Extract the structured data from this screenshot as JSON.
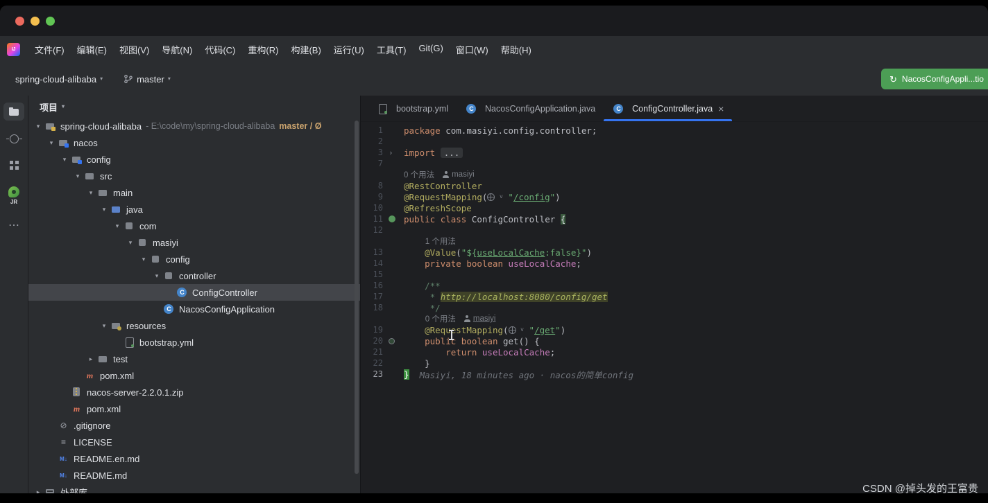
{
  "window": {
    "watermark": "CSDN @掉头发的王富贵"
  },
  "menu_bar": {
    "logo": "IJ",
    "items": [
      "文件(F)",
      "编辑(E)",
      "视图(V)",
      "导航(N)",
      "代码(C)",
      "重构(R)",
      "构建(B)",
      "运行(U)",
      "工具(T)",
      "Git(G)",
      "窗口(W)",
      "帮助(H)"
    ]
  },
  "toolbar": {
    "project_selector": "spring-cloud-alibaba",
    "branch": "master",
    "run_config_label": "NacosConfigAppli...tio"
  },
  "tool_stripe": {
    "items": [
      {
        "name": "project-tool-window",
        "icon": "folder",
        "active": true
      },
      {
        "name": "commit-tool-window",
        "icon": "commit"
      },
      {
        "name": "structure-tool-window",
        "icon": "structure"
      },
      {
        "name": "jrebel-plugin",
        "icon": "jrebel",
        "label": "JR"
      },
      {
        "name": "more-tool-windows",
        "icon": "more"
      }
    ]
  },
  "project_tree": {
    "header": "项目",
    "items": [
      {
        "level": 0,
        "label": "spring-cloud-alibaba",
        "suffix": "- E:\\code\\my\\spring-cloud-alibaba",
        "badge": "master / Ø",
        "icon": "project",
        "expanded": true
      },
      {
        "level": 1,
        "label": "nacos",
        "icon": "module",
        "expanded": true
      },
      {
        "level": 2,
        "label": "config",
        "icon": "module",
        "expanded": true
      },
      {
        "level": 3,
        "label": "src",
        "icon": "folder",
        "expanded": true
      },
      {
        "level": 4,
        "label": "main",
        "icon": "folder",
        "expanded": true
      },
      {
        "level": 5,
        "label": "java",
        "icon": "srcfolder",
        "expanded": true
      },
      {
        "level": 6,
        "label": "com",
        "icon": "package",
        "expanded": true
      },
      {
        "level": 7,
        "label": "masiyi",
        "icon": "package",
        "expanded": true
      },
      {
        "level": 8,
        "label": "config",
        "icon": "package",
        "expanded": true
      },
      {
        "level": 9,
        "label": "controller",
        "icon": "package",
        "expanded": true
      },
      {
        "level": 10,
        "label": "ConfigController",
        "icon": "class",
        "selected": true
      },
      {
        "level": 9,
        "label": "NacosConfigApplication",
        "icon": "class"
      },
      {
        "level": 5,
        "label": "resources",
        "icon": "resources",
        "expanded": true
      },
      {
        "level": 6,
        "label": "bootstrap.yml",
        "icon": "yml"
      },
      {
        "level": 4,
        "label": "test",
        "icon": "folder",
        "expanded": false
      },
      {
        "level": 3,
        "label": "pom.xml",
        "icon": "maven"
      },
      {
        "level": 2,
        "label": "nacos-server-2.2.0.1.zip",
        "icon": "archive"
      },
      {
        "level": 2,
        "label": "pom.xml",
        "icon": "maven"
      },
      {
        "level": 1,
        "label": ".gitignore",
        "icon": "gitignore"
      },
      {
        "level": 1,
        "label": "LICENSE",
        "icon": "license"
      },
      {
        "level": 1,
        "label": "README.en.md",
        "icon": "markdown"
      },
      {
        "level": 1,
        "label": "README.md",
        "icon": "markdown"
      },
      {
        "level": 0,
        "label": "外部库",
        "icon": "lib",
        "expanded": false
      }
    ]
  },
  "editor": {
    "tabs": [
      {
        "label": "bootstrap.yml",
        "icon": "yml",
        "active": false
      },
      {
        "label": "NacosConfigApplication.java",
        "icon": "class",
        "active": false
      },
      {
        "label": "ConfigController.java",
        "icon": "class",
        "active": true,
        "closable": true
      }
    ],
    "lines": [
      {
        "n": "1",
        "seg": [
          [
            "package",
            "kw"
          ],
          [
            " com.masiyi.config.controller;",
            "pl"
          ]
        ]
      },
      {
        "n": "2",
        "seg": []
      },
      {
        "n": "3",
        "fold": true,
        "seg": [
          [
            "import",
            "kw"
          ],
          [
            " ",
            "pl"
          ],
          [
            "...",
            "foldchip"
          ]
        ]
      },
      {
        "n": "7",
        "seg": []
      },
      {
        "inlay": [
          [
            "0 个用法",
            "hint"
          ],
          [
            "",
            "icon-person"
          ],
          [
            "masiyi",
            "hint"
          ]
        ],
        "indent": 0
      },
      {
        "n": "8",
        "seg": [
          [
            "@RestController",
            "ann"
          ]
        ]
      },
      {
        "n": "9",
        "seg": [
          [
            "@RequestMapping",
            "ann"
          ],
          [
            "(",
            "pl"
          ],
          [
            "",
            "icon-globe"
          ],
          [
            "v",
            "chev"
          ],
          [
            "\"",
            "str"
          ],
          [
            "/config",
            "strlink"
          ],
          [
            "\"",
            "str"
          ],
          [
            ")",
            "pl"
          ]
        ]
      },
      {
        "n": "10",
        "seg": [
          [
            "@RefreshScope",
            "ann"
          ]
        ]
      },
      {
        "n": "11",
        "gutter": "spring-bean",
        "seg": [
          [
            "public",
            "kw"
          ],
          [
            " ",
            "pl"
          ],
          [
            "class",
            "kw"
          ],
          [
            " ConfigController ",
            "pl"
          ],
          [
            "{",
            "brace"
          ]
        ]
      },
      {
        "n": "12",
        "seg": []
      },
      {
        "inlay": [
          [
            "1 个用法",
            "hint"
          ]
        ],
        "indent": 4
      },
      {
        "n": "13",
        "seg": [
          [
            "    ",
            "pl"
          ],
          [
            "@Value",
            "ann"
          ],
          [
            "(",
            "pl"
          ],
          [
            "\"${",
            "str"
          ],
          [
            "useLocalCache",
            "strlink"
          ],
          [
            ":false",
            "str"
          ],
          [
            "}\"",
            "str"
          ],
          [
            ")",
            "pl"
          ]
        ]
      },
      {
        "n": "14",
        "seg": [
          [
            "    ",
            "pl"
          ],
          [
            "private",
            "kw"
          ],
          [
            " ",
            "pl"
          ],
          [
            "boolean",
            "kw"
          ],
          [
            " ",
            "pl"
          ],
          [
            "useLocalCache",
            "fld"
          ],
          [
            ";",
            "pl"
          ]
        ]
      },
      {
        "n": "15",
        "seg": []
      },
      {
        "n": "16",
        "seg": [
          [
            "    ",
            "pl"
          ],
          [
            "/**",
            "doc"
          ]
        ]
      },
      {
        "n": "17",
        "seg": [
          [
            "     ",
            "pl"
          ],
          [
            "* ",
            "doc"
          ],
          [
            "http://localhost:8080/config/get",
            "dochl"
          ]
        ]
      },
      {
        "n": "18",
        "seg": [
          [
            "     ",
            "pl"
          ],
          [
            "*/",
            "doc"
          ]
        ]
      },
      {
        "inlay": [
          [
            "0 个用法",
            "hint"
          ],
          [
            "",
            "icon-person"
          ],
          [
            "masiyi",
            "hintlink"
          ]
        ],
        "indent": 4
      },
      {
        "n": "19",
        "seg": [
          [
            "    ",
            "pl"
          ],
          [
            "@RequestMapping",
            "ann"
          ],
          [
            "(",
            "pl"
          ],
          [
            "",
            "icon-globe"
          ],
          [
            "v",
            "chev"
          ],
          [
            "\"",
            "str"
          ],
          [
            "/get",
            "strlink"
          ],
          [
            "\"",
            "str"
          ],
          [
            ")",
            "pl"
          ]
        ]
      },
      {
        "n": "20",
        "gutter": "request-mapping",
        "seg": [
          [
            "    ",
            "pl"
          ],
          [
            "public",
            "kw"
          ],
          [
            " ",
            "pl"
          ],
          [
            "boolean",
            "kw"
          ],
          [
            " get() {",
            "pl"
          ]
        ]
      },
      {
        "n": "21",
        "seg": [
          [
            "        ",
            "pl"
          ],
          [
            "return",
            "kw"
          ],
          [
            " ",
            "pl"
          ],
          [
            "useLocalCache",
            "fld"
          ],
          [
            ";",
            "pl"
          ]
        ]
      },
      {
        "n": "22",
        "seg": [
          [
            "    }",
            "pl"
          ]
        ]
      },
      {
        "n": "23",
        "cur": true,
        "seg": [
          [
            "}",
            "caret"
          ],
          [
            "  Masiyi, 18 minutes ago · nacos的简单config",
            "blame"
          ]
        ]
      }
    ]
  },
  "colors": {
    "accent_blue": "#3574f0",
    "run_green": "#4c9e55",
    "keyword_orange": "#cf8e6d",
    "string_green": "#6aab73",
    "annotation_yellow": "#b3ae60",
    "field_purple": "#c77dbb",
    "selection_gray": "#43454a"
  }
}
